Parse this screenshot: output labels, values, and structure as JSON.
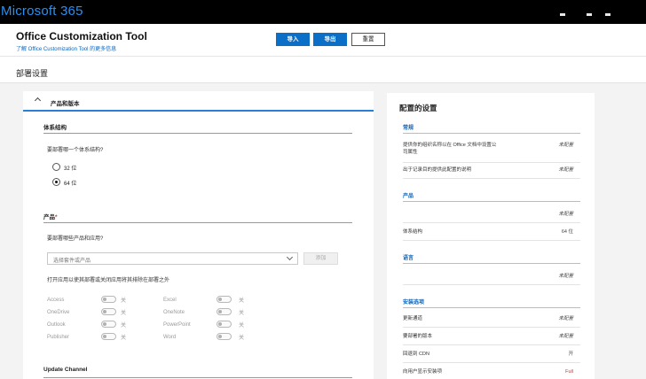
{
  "topbar": {
    "brand": "Microsoft 365"
  },
  "header": {
    "app_title": "Office Customization Tool",
    "learn_more": "了解 Office Customization Tool 的更多信息",
    "buttons": {
      "import": "导入",
      "export": "导出",
      "reset": "重置"
    }
  },
  "subheader": {
    "title": "部署设置"
  },
  "left": {
    "accordion_title": "产品和版本",
    "arch": {
      "title": "体系结构",
      "question": "要部署哪一个体系结构?",
      "options": [
        "32 位",
        "64 位"
      ],
      "selected": "64 位"
    },
    "products": {
      "title": "产品",
      "required_mark": "*",
      "question": "要部署哪些产品和应用?",
      "select_placeholder": "选择套件或产品",
      "add_label": "添加",
      "apps_hint": "打开应用以使其部署或关闭应用将其排除在部署之外",
      "off_label": "关",
      "apps": [
        {
          "name": "Access",
          "on": false
        },
        {
          "name": "Excel",
          "on": false
        },
        {
          "name": "OneDrive",
          "on": false
        },
        {
          "name": "OneNote",
          "on": false
        },
        {
          "name": "Outlook",
          "on": false
        },
        {
          "name": "PowerPoint",
          "on": false
        },
        {
          "name": "Publisher",
          "on": false
        },
        {
          "name": "Word",
          "on": false
        }
      ]
    },
    "update_channel": {
      "title": "Update Channel"
    }
  },
  "right": {
    "title": "配置的设置",
    "sections": {
      "general": "常规",
      "products": "产品",
      "language": "语言",
      "install": "安装选项"
    },
    "rows": {
      "org_name": {
        "k": "提供你的组织名称以在 Office 文档中设置公司属性",
        "v": "未配置"
      },
      "description": {
        "k": "出于记录目的提供此配置的说明",
        "v": "未配置"
      },
      "products_v": {
        "k": "",
        "v": "未配置"
      },
      "arch": {
        "k": "体系结构",
        "v": "64 位"
      },
      "language_v": {
        "k": "",
        "v": "未配置"
      },
      "update_channel": {
        "k": "更新通道",
        "v": "未配置"
      },
      "version": {
        "k": "要部署的版本",
        "v": "未配置"
      },
      "fallback_cdn": {
        "k": "回退到 CDN",
        "v": "开"
      },
      "show_install": {
        "k": "向用户显示安装项",
        "v": "Full"
      }
    }
  },
  "colors": {
    "accent": "#0b6fc7",
    "brand": "#2b8ff0",
    "topbar": "#000000"
  }
}
